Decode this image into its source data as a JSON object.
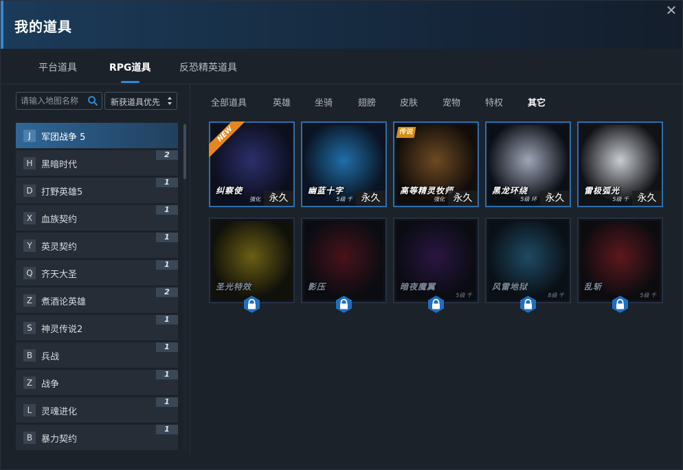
{
  "window": {
    "title": "我的道具",
    "close_label": "✕"
  },
  "top_tabs": [
    {
      "label": "平台道具",
      "active": false
    },
    {
      "label": "RPG道具",
      "active": true
    },
    {
      "label": "反恐精英道具",
      "active": false
    }
  ],
  "search": {
    "placeholder": "请输入地图名称",
    "value": ""
  },
  "sort": {
    "value": "新获道具优先"
  },
  "maps": [
    {
      "letter": "J",
      "name": "军团战争 5",
      "count": "",
      "active": true
    },
    {
      "letter": "H",
      "name": "黑暗时代",
      "count": "2",
      "active": false
    },
    {
      "letter": "D",
      "name": "打野英雄5",
      "count": "1",
      "active": false
    },
    {
      "letter": "X",
      "name": "血族契约",
      "count": "1",
      "active": false
    },
    {
      "letter": "Y",
      "name": "英灵契约",
      "count": "1",
      "active": false
    },
    {
      "letter": "Q",
      "name": "齐天大圣",
      "count": "1",
      "active": false
    },
    {
      "letter": "Z",
      "name": "煮酒论英雄",
      "count": "2",
      "active": false
    },
    {
      "letter": "S",
      "name": "神灵传说2",
      "count": "1",
      "active": false
    },
    {
      "letter": "B",
      "name": "兵战",
      "count": "1",
      "active": false
    },
    {
      "letter": "Z",
      "name": "战争",
      "count": "1",
      "active": false
    },
    {
      "letter": "L",
      "name": "灵魂进化",
      "count": "1",
      "active": false
    },
    {
      "letter": "B",
      "name": "暴力契约",
      "count": "1",
      "active": false
    }
  ],
  "category_tabs": [
    {
      "label": "全部道具",
      "active": false
    },
    {
      "label": "英雄",
      "active": false
    },
    {
      "label": "坐骑",
      "active": false
    },
    {
      "label": "翅膀",
      "active": false
    },
    {
      "label": "皮肤",
      "active": false
    },
    {
      "label": "宠物",
      "active": false
    },
    {
      "label": "特权",
      "active": false
    },
    {
      "label": "其它",
      "active": true
    }
  ],
  "items": [
    {
      "caption": "纠察使",
      "sub": "强化",
      "duration": "永久",
      "owned": true,
      "tag": "NEW",
      "colors": [
        "#2b2f6a",
        "#0d0f1f"
      ]
    },
    {
      "caption": "幽蓝十字",
      "sub": "5级 千",
      "duration": "永久",
      "owned": true,
      "tag": "",
      "colors": [
        "#1f6fa8",
        "#0a1424"
      ]
    },
    {
      "caption": "高等精灵牧师",
      "sub": "强化",
      "duration": "永久",
      "owned": true,
      "tag": "传说",
      "colors": [
        "#6e4a22",
        "#120d0a"
      ]
    },
    {
      "caption": "黑龙环绕",
      "sub": "5级 环",
      "duration": "永久",
      "owned": true,
      "tag": "",
      "colors": [
        "#9fa6b8",
        "#0c0f16"
      ]
    },
    {
      "caption": "雷极弧光",
      "sub": "5级 千",
      "duration": "永久",
      "owned": true,
      "tag": "",
      "colors": [
        "#c9ccd2",
        "#101216"
      ]
    },
    {
      "caption": "圣光特效",
      "sub": "",
      "duration": "",
      "owned": false,
      "tag": "",
      "colors": [
        "#a08a12",
        "#151306"
      ]
    },
    {
      "caption": "影压",
      "sub": "",
      "duration": "",
      "owned": false,
      "tag": "",
      "colors": [
        "#6b1420",
        "#0c0c10"
      ]
    },
    {
      "caption": "暗夜魔翼",
      "sub": "5级 千",
      "duration": "",
      "owned": false,
      "tag": "",
      "colors": [
        "#3c1a5a",
        "#0b0b12"
      ]
    },
    {
      "caption": "风雷地狱",
      "sub": "8级 千",
      "duration": "",
      "owned": false,
      "tag": "",
      "colors": [
        "#2b6a8f",
        "#0b1118"
      ]
    },
    {
      "caption": "乱斩",
      "sub": "5级 千",
      "duration": "",
      "owned": false,
      "tag": "",
      "colors": [
        "#8a1d22",
        "#0e0b0d"
      ]
    }
  ]
}
